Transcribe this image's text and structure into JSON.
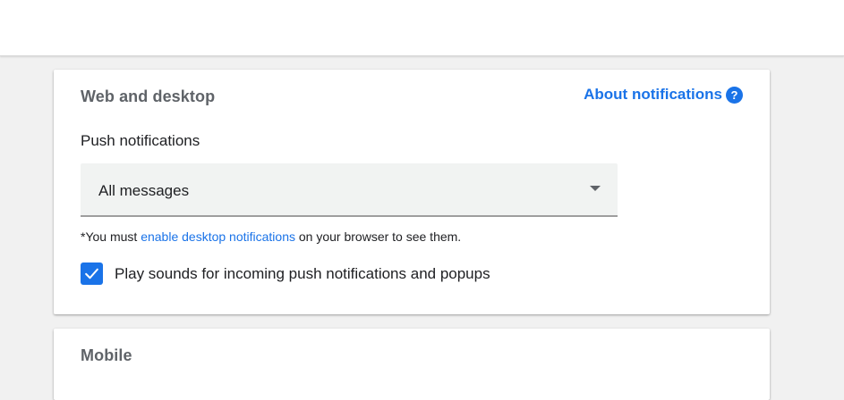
{
  "web_section": {
    "title": "Web and desktop",
    "about_link": "About notifications",
    "help_icon": "?",
    "push_label": "Push notifications",
    "select": {
      "value": "All messages"
    },
    "note": {
      "prefix": "*You must ",
      "link": "enable desktop notifications",
      "suffix": " on your browser to see them."
    },
    "sound_checkbox": {
      "label": "Play sounds for incoming push notifications and popups",
      "checked": true
    }
  },
  "mobile_section": {
    "title": "Mobile"
  },
  "icons": {
    "help": "help-circle-icon",
    "dropdown": "chevron-down-icon",
    "check": "checkmark-icon"
  },
  "colors": {
    "accent": "#1a73e8",
    "page_bg": "#f1f1f1",
    "field_bg": "#f1f3f2",
    "title_gray": "#5f6368"
  }
}
